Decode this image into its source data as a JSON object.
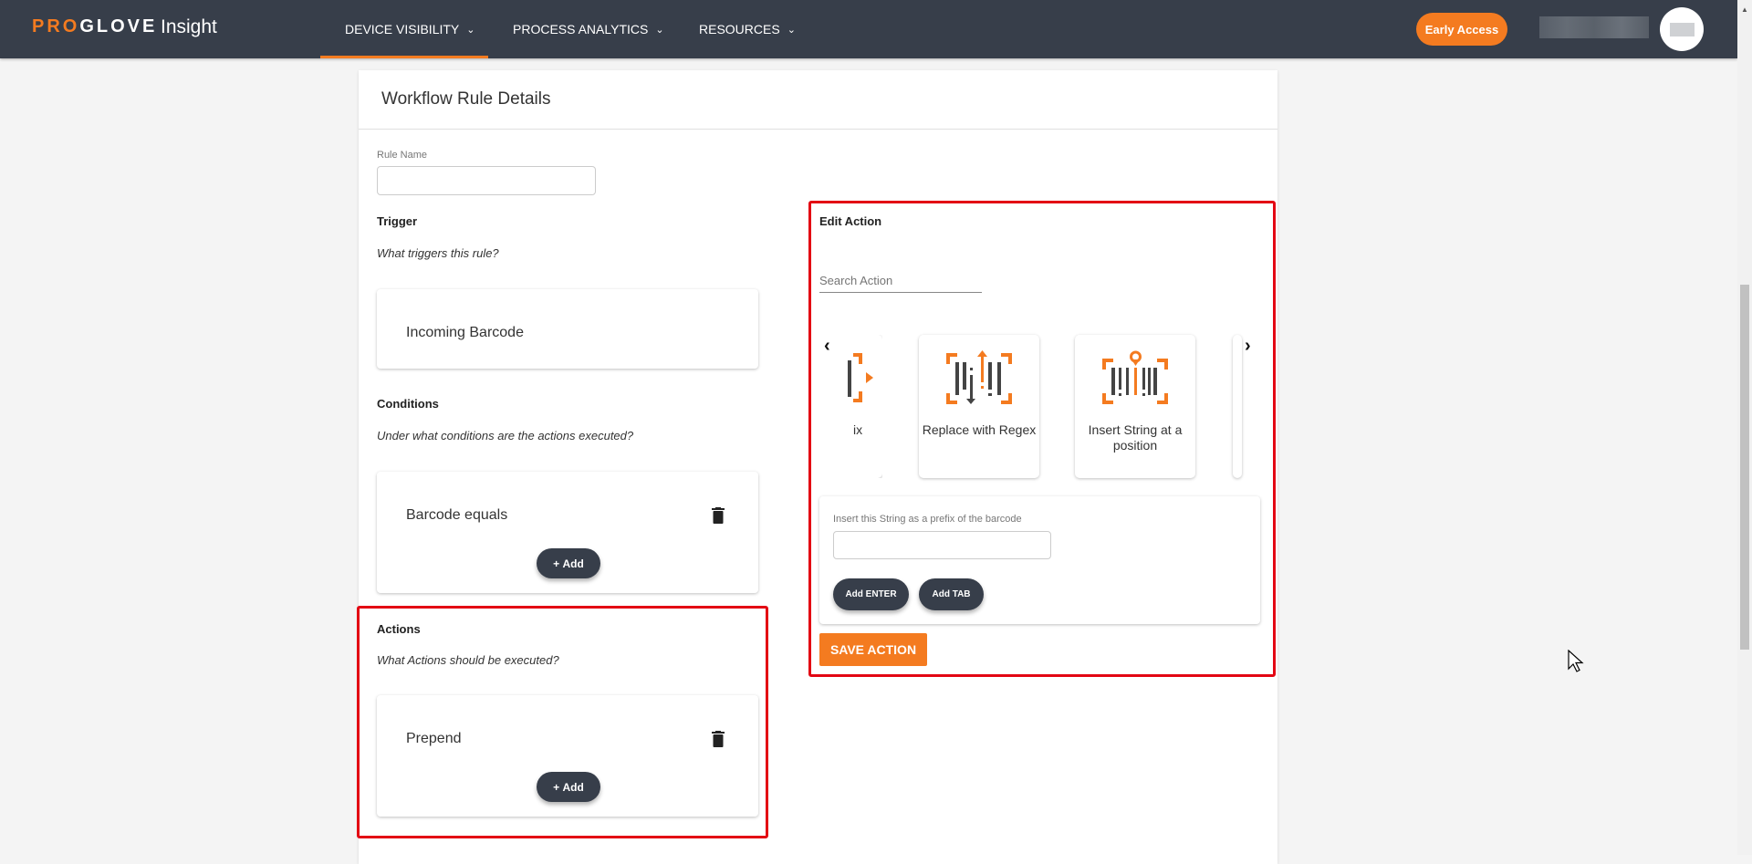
{
  "header": {
    "logo_pro": "PRO",
    "logo_glove": "GLOVE",
    "logo_sub": "Insight",
    "nav": [
      {
        "label": "DEVICE VISIBILITY"
      },
      {
        "label": "PROCESS ANALYTICS"
      },
      {
        "label": "RESOURCES"
      }
    ],
    "early_access": "Early Access"
  },
  "page": {
    "title": "Workflow Rule Details",
    "rule_name_label": "Rule Name",
    "rule_name_value": "",
    "trigger": {
      "heading": "Trigger",
      "question": "What triggers this rule?",
      "item": "Incoming Barcode"
    },
    "conditions": {
      "heading": "Conditions",
      "question": "Under what conditions are the actions executed?",
      "item": "Barcode equals",
      "add": "Add"
    },
    "actions": {
      "heading": "Actions",
      "question": "What Actions should be executed?",
      "item": "Prepend",
      "add": "Add"
    }
  },
  "edit_action": {
    "heading": "Edit Action",
    "search_placeholder": "Search Action",
    "cards": [
      {
        "label": "ix"
      },
      {
        "label": "Replace with Regex"
      },
      {
        "label": "Insert String at a position"
      }
    ],
    "prefix_label": "Insert this String as a prefix of the barcode",
    "prefix_value": "",
    "add_enter": "Add ENTER",
    "add_tab": "Add TAB",
    "save": "SAVE ACTION"
  },
  "colors": {
    "accent": "#f47b20",
    "header": "#373e4a",
    "highlight": "#e30613"
  }
}
